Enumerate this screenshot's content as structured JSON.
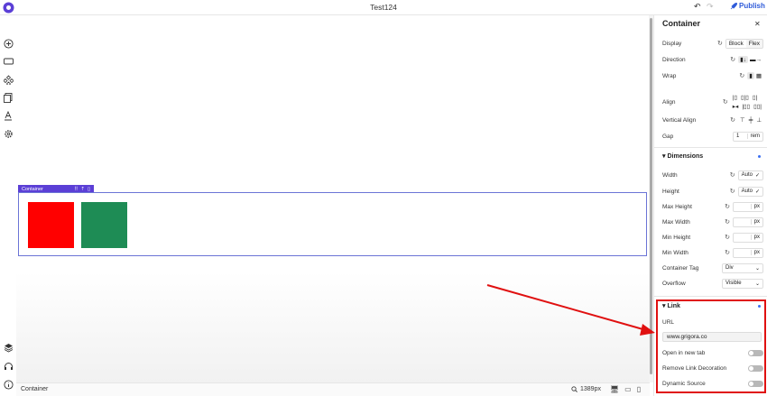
{
  "header": {
    "title": "Test124",
    "publish_label": "Publish"
  },
  "footer": {
    "breadcrumb": "Container",
    "zoom": "1389px"
  },
  "canvas": {
    "container_label": "Container",
    "boxes": [
      {
        "color": "#ff0000"
      },
      {
        "color": "#1e8c55"
      }
    ]
  },
  "panel": {
    "title": "Container",
    "display": {
      "label": "Display",
      "options": [
        "Block",
        "Flex"
      ],
      "selected": "Block"
    },
    "direction_label": "Direction",
    "wrap_label": "Wrap",
    "align_label": "Align",
    "vertical_align_label": "Vertical Align",
    "gap": {
      "label": "Gap",
      "value": "1",
      "unit": "rem"
    },
    "dimensions": {
      "heading": "Dimensions",
      "width": {
        "label": "Width",
        "value": "Auto"
      },
      "height": {
        "label": "Height",
        "value": "Auto"
      },
      "max_height": {
        "label": "Max Height",
        "unit": "px"
      },
      "max_width": {
        "label": "Max Width",
        "unit": "px"
      },
      "min_height": {
        "label": "Min Height",
        "unit": "px"
      },
      "min_width": {
        "label": "Min Width",
        "unit": "px"
      },
      "container_tag": {
        "label": "Container Tag",
        "value": "Div"
      },
      "overflow": {
        "label": "Overflow",
        "value": "Visible"
      }
    },
    "link": {
      "heading": "Link",
      "url_label": "URL",
      "url_value": "www.grigora.co",
      "open_new_tab": {
        "label": "Open in new tab",
        "on": false
      },
      "remove_decoration": {
        "label": "Remove Link Decoration",
        "on": false
      },
      "dynamic_source": {
        "label": "Dynamic Source",
        "on": false
      }
    }
  },
  "colors": {
    "accent": "#5b3fd6",
    "publish": "#2f5bd9",
    "annotation": "#e01010"
  }
}
